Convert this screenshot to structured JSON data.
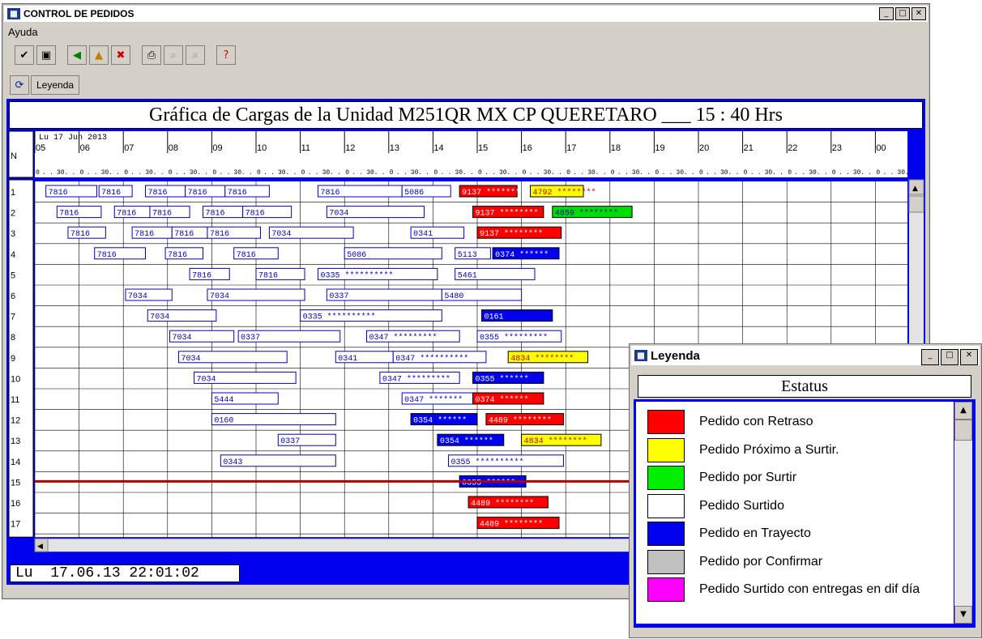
{
  "window": {
    "title": "CONTROL DE PEDIDOS",
    "menu": [
      "Ayuda"
    ],
    "legend_button": "Leyenda"
  },
  "chart": {
    "title": "Gráfica de Cargas de la Unidad M251QR MX CP QUERETARO ___ 15 : 40 Hrs",
    "date_label": "Lu 17 Jun 2013",
    "row_axis_label": "N",
    "hours": [
      "05",
      "06",
      "07",
      "08",
      "09",
      "10",
      "11",
      "12",
      "13",
      "14",
      "15",
      "16",
      "17",
      "18",
      "19",
      "20",
      "21",
      "22",
      "23",
      "00"
    ],
    "rows": [
      "1",
      "2",
      "3",
      "4",
      "5",
      "6",
      "7",
      "8",
      "9",
      "10",
      "11",
      "12",
      "13",
      "14",
      "15",
      "16",
      "17"
    ],
    "status_text": "Lu  17.06.13 22:01:02",
    "colors": {
      "red": "#ff0000",
      "yellow": "#ffff00",
      "green": "#00dd00",
      "white": "#ffffff",
      "blue": "#0000ee"
    },
    "bars": [
      {
        "row": 1,
        "s": 5.25,
        "e": 6.4,
        "label": "7816",
        "st": "white"
      },
      {
        "row": 1,
        "s": 6.45,
        "e": 7.2,
        "label": "7816",
        "st": "white"
      },
      {
        "row": 1,
        "s": 7.5,
        "e": 8.4,
        "label": "7816",
        "st": "white"
      },
      {
        "row": 1,
        "s": 8.4,
        "e": 9.3,
        "label": "7816",
        "st": "white"
      },
      {
        "row": 1,
        "s": 9.3,
        "e": 10.3,
        "label": "7816",
        "st": "white"
      },
      {
        "row": 1,
        "s": 11.4,
        "e": 13.3,
        "label": "7816",
        "st": "white"
      },
      {
        "row": 1,
        "s": 13.3,
        "e": 14.4,
        "label": "5086",
        "st": "white"
      },
      {
        "row": 1,
        "s": 14.6,
        "e": 15.9,
        "label": "9137 ********",
        "st": "red"
      },
      {
        "row": 1,
        "s": 16.2,
        "e": 17.4,
        "label": "4792 ********",
        "st": "yellow"
      },
      {
        "row": 2,
        "s": 5.5,
        "e": 6.5,
        "label": "7816",
        "st": "white"
      },
      {
        "row": 2,
        "s": 6.8,
        "e": 7.6,
        "label": "7816",
        "st": "white"
      },
      {
        "row": 2,
        "s": 7.6,
        "e": 8.5,
        "label": "7816",
        "st": "white"
      },
      {
        "row": 2,
        "s": 8.8,
        "e": 9.7,
        "label": "7816",
        "st": "white"
      },
      {
        "row": 2,
        "s": 9.7,
        "e": 10.8,
        "label": "7816",
        "st": "white"
      },
      {
        "row": 2,
        "s": 11.6,
        "e": 13.8,
        "label": "7034",
        "st": "white"
      },
      {
        "row": 2,
        "s": 14.9,
        "e": 16.5,
        "label": "9137 ********",
        "st": "red"
      },
      {
        "row": 2,
        "s": 16.7,
        "e": 18.5,
        "label": "4859 ********",
        "st": "green"
      },
      {
        "row": 3,
        "s": 5.75,
        "e": 6.6,
        "label": "7816",
        "st": "white"
      },
      {
        "row": 3,
        "s": 7.2,
        "e": 8.1,
        "label": "7816",
        "st": "white"
      },
      {
        "row": 3,
        "s": 8.1,
        "e": 8.9,
        "label": "7816",
        "st": "white"
      },
      {
        "row": 3,
        "s": 8.9,
        "e": 10.1,
        "label": "7816",
        "st": "white"
      },
      {
        "row": 3,
        "s": 10.3,
        "e": 12.2,
        "label": "7034",
        "st": "white"
      },
      {
        "row": 3,
        "s": 13.5,
        "e": 14.7,
        "label": "0341",
        "st": "white"
      },
      {
        "row": 3,
        "s": 15.0,
        "e": 16.9,
        "label": "9137 ********",
        "st": "red"
      },
      {
        "row": 4,
        "s": 6.35,
        "e": 7.5,
        "label": "7816",
        "st": "white"
      },
      {
        "row": 4,
        "s": 7.95,
        "e": 8.8,
        "label": "7816",
        "st": "white"
      },
      {
        "row": 4,
        "s": 9.5,
        "e": 10.5,
        "label": "7816",
        "st": "white"
      },
      {
        "row": 4,
        "s": 12.0,
        "e": 14.2,
        "label": "5086",
        "st": "white"
      },
      {
        "row": 4,
        "s": 14.5,
        "e": 15.3,
        "label": "5113",
        "st": "white"
      },
      {
        "row": 4,
        "s": 15.35,
        "e": 16.85,
        "label": "0374 ******",
        "st": "blue"
      },
      {
        "row": 5,
        "s": 8.5,
        "e": 9.4,
        "label": "7816",
        "st": "white"
      },
      {
        "row": 5,
        "s": 10.0,
        "e": 11.1,
        "label": "7816",
        "st": "white"
      },
      {
        "row": 5,
        "s": 11.4,
        "e": 14.1,
        "label": "0335 **********",
        "st": "white"
      },
      {
        "row": 5,
        "s": 14.5,
        "e": 16.3,
        "label": "5461",
        "st": "white"
      },
      {
        "row": 6,
        "s": 7.05,
        "e": 8.1,
        "label": "7034",
        "st": "white"
      },
      {
        "row": 6,
        "s": 8.9,
        "e": 11.1,
        "label": "7034",
        "st": "white"
      },
      {
        "row": 6,
        "s": 11.6,
        "e": 14.2,
        "label": "0337",
        "st": "white"
      },
      {
        "row": 6,
        "s": 14.2,
        "e": 16.0,
        "label": "5480",
        "st": "white"
      },
      {
        "row": 7,
        "s": 7.55,
        "e": 9.1,
        "label": "7034",
        "st": "white"
      },
      {
        "row": 7,
        "s": 11.0,
        "e": 14.2,
        "label": "0335 **********",
        "st": "white"
      },
      {
        "row": 7,
        "s": 15.1,
        "e": 16.7,
        "label": "0161",
        "st": "blue"
      },
      {
        "row": 8,
        "s": 8.05,
        "e": 9.5,
        "label": "7034",
        "st": "white"
      },
      {
        "row": 8,
        "s": 9.6,
        "e": 11.9,
        "label": "0337",
        "st": "white"
      },
      {
        "row": 8,
        "s": 12.5,
        "e": 14.6,
        "label": "0347 *********",
        "st": "white"
      },
      {
        "row": 8,
        "s": 15.0,
        "e": 16.9,
        "label": "0355 *********",
        "st": "white"
      },
      {
        "row": 9,
        "s": 8.25,
        "e": 10.7,
        "label": "7034",
        "st": "white"
      },
      {
        "row": 9,
        "s": 11.8,
        "e": 13.1,
        "label": "0341",
        "st": "white"
      },
      {
        "row": 9,
        "s": 13.1,
        "e": 15.2,
        "label": "0347 **********",
        "st": "white"
      },
      {
        "row": 9,
        "s": 15.7,
        "e": 17.5,
        "label": "4834 ********",
        "st": "yellow"
      },
      {
        "row": 10,
        "s": 8.6,
        "e": 10.9,
        "label": "7034",
        "st": "white"
      },
      {
        "row": 10,
        "s": 12.8,
        "e": 14.6,
        "label": "0347 *********",
        "st": "white"
      },
      {
        "row": 10,
        "s": 14.9,
        "e": 16.5,
        "label": "0355 ******",
        "st": "blue"
      },
      {
        "row": 11,
        "s": 9.0,
        "e": 10.5,
        "label": "5444",
        "st": "white"
      },
      {
        "row": 11,
        "s": 13.3,
        "e": 14.9,
        "label": "0347 *******",
        "st": "white"
      },
      {
        "row": 11,
        "s": 14.9,
        "e": 16.5,
        "label": "0374 ******",
        "st": "red"
      },
      {
        "row": 12,
        "s": 9.0,
        "e": 11.8,
        "label": "0160",
        "st": "white"
      },
      {
        "row": 12,
        "s": 13.5,
        "e": 15.0,
        "label": "0354 ******",
        "st": "blue"
      },
      {
        "row": 12,
        "s": 15.2,
        "e": 16.95,
        "label": "4489 ********",
        "st": "red"
      },
      {
        "row": 13,
        "s": 10.5,
        "e": 11.8,
        "label": "0337",
        "st": "white"
      },
      {
        "row": 13,
        "s": 14.1,
        "e": 15.6,
        "label": "0354 ******",
        "st": "blue"
      },
      {
        "row": 13,
        "s": 16.0,
        "e": 17.8,
        "label": "4834 ********",
        "st": "yellow"
      },
      {
        "row": 14,
        "s": 9.2,
        "e": 11.8,
        "label": "0343",
        "st": "white"
      },
      {
        "row": 14,
        "s": 14.35,
        "e": 16.95,
        "label": "0355 **********",
        "st": "white"
      },
      {
        "row": 15,
        "s": 14.6,
        "e": 16.1,
        "label": "0355 ******",
        "st": "blue"
      },
      {
        "row": 16,
        "s": 14.8,
        "e": 16.6,
        "label": "4489 ********",
        "st": "red"
      },
      {
        "row": 17,
        "s": 15.0,
        "e": 16.85,
        "label": "4489 ********",
        "st": "red"
      }
    ]
  },
  "legend": {
    "title": "Leyenda",
    "header": "Estatus",
    "items": [
      {
        "label": "Pedido con Retraso",
        "color": "#ff0000"
      },
      {
        "label": "Pedido Próximo a Surtir.",
        "color": "#ffff00"
      },
      {
        "label": "Pedido por Surtir",
        "color": "#00ee00"
      },
      {
        "label": "Pedido Surtido",
        "color": "#ffffff"
      },
      {
        "label": "Pedido en Trayecto",
        "color": "#0000ee"
      },
      {
        "label": "Pedido por Confirmar",
        "color": "#c0c0c0"
      },
      {
        "label": "Pedido Surtido con entregas en dif día",
        "color": "#ff00ff"
      }
    ]
  }
}
